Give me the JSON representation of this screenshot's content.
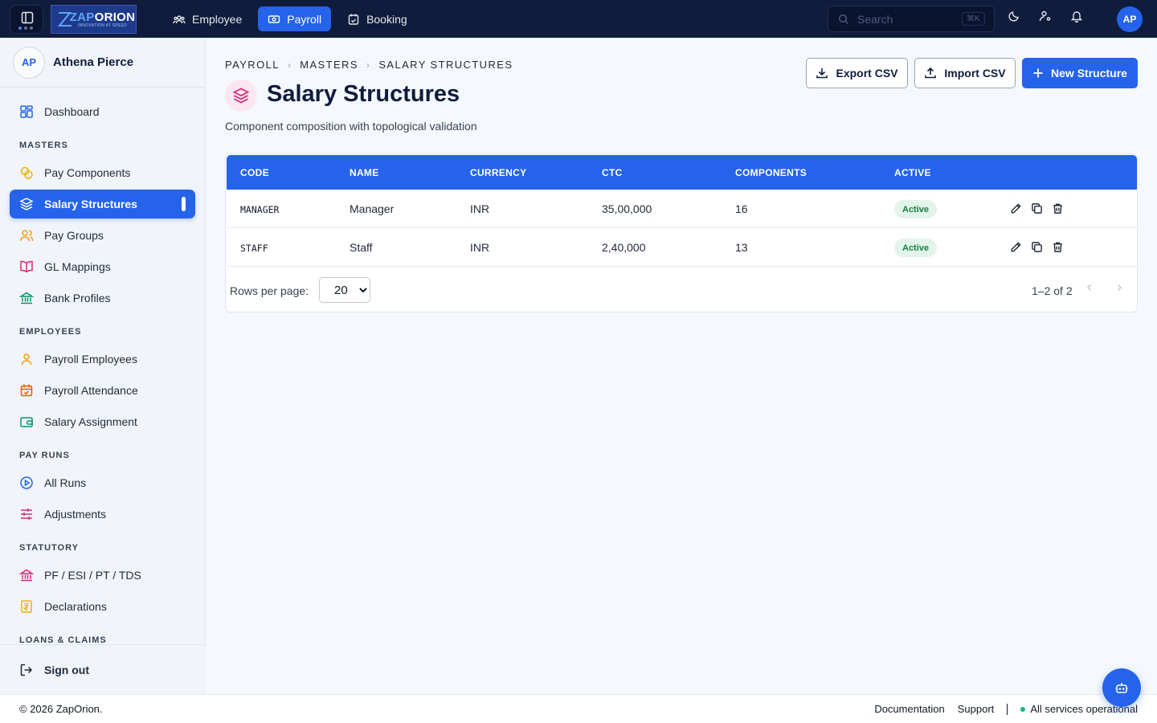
{
  "topbar": {
    "logo_text_1": "ZAP",
    "logo_text_2": "ORION",
    "logo_tagline": "INNOVATION AT SPEED",
    "nav": [
      {
        "label": "Employee",
        "icon": "users-icon"
      },
      {
        "label": "Payroll",
        "icon": "banknote-icon",
        "active": true
      },
      {
        "label": "Booking",
        "icon": "calendar-check-icon"
      }
    ],
    "search_placeholder": "Search",
    "search_shortcut": "⌘K",
    "avatar": "AP"
  },
  "sidebar": {
    "user_initials": "AP",
    "user_name": "Athena Pierce",
    "dashboard": "Dashboard",
    "sections": {
      "masters": "MASTERS",
      "employees": "EMPLOYEES",
      "pay_runs": "PAY RUNS",
      "statutory": "STATUTORY",
      "loans": "LOANS & CLAIMS"
    },
    "items": {
      "pay_components": "Pay Components",
      "salary_structures": "Salary Structures",
      "pay_groups": "Pay Groups",
      "gl_mappings": "GL Mappings",
      "bank_profiles": "Bank Profiles",
      "payroll_employees": "Payroll Employees",
      "payroll_attendance": "Payroll Attendance",
      "salary_assignment": "Salary Assignment",
      "all_runs": "All Runs",
      "adjustments": "Adjustments",
      "pf_esi": "PF / ESI / PT / TDS",
      "declarations": "Declarations"
    },
    "signout": "Sign out"
  },
  "main": {
    "breadcrumb": [
      "PAYROLL",
      "MASTERS",
      "SALARY STRUCTURES"
    ],
    "title": "Salary Structures",
    "subtitle": "Component composition with topological validation",
    "buttons": {
      "export": "Export CSV",
      "import": "Import CSV",
      "new": "New Structure"
    },
    "table": {
      "headers": [
        "CODE",
        "NAME",
        "CURRENCY",
        "CTC",
        "COMPONENTS",
        "ACTIVE"
      ],
      "rows": [
        {
          "code": "MANAGER",
          "name": "Manager",
          "currency": "INR",
          "ctc": "35,00,000",
          "components": "16",
          "active": "Active"
        },
        {
          "code": "STAFF",
          "name": "Staff",
          "currency": "INR",
          "ctc": "2,40,000",
          "components": "13",
          "active": "Active"
        }
      ]
    },
    "pagination": {
      "rows_per_page_label": "Rows per page:",
      "rows_per_page": "20",
      "range": "1–2 of 2"
    }
  },
  "footer": {
    "copyright": "© 2026 ZapOrion.",
    "documentation": "Documentation",
    "support": "Support",
    "status": "All services operational"
  },
  "colors": {
    "brand": "#2563eb",
    "topbar": "#0f1c3c",
    "active_badge_bg": "#e3f5ea",
    "active_badge_text": "#15803d"
  }
}
